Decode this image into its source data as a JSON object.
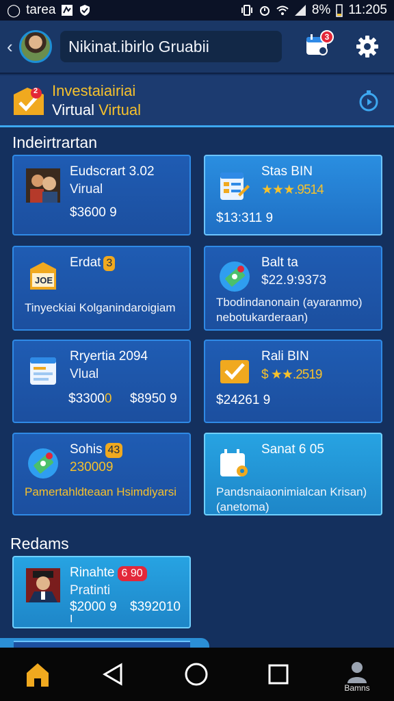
{
  "status_bar": {
    "carrier": "tarea",
    "battery": "8%",
    "time": "11:205"
  },
  "header": {
    "title": "Nikinat.ibirlo Gruabii",
    "calendar_badge": "3"
  },
  "banner": {
    "line1": "Investaiairiai",
    "line2_a": "Virtual",
    "line2_b": "Virtual",
    "badge": "2"
  },
  "section_investments": "Indeirtrartan",
  "cards": [
    {
      "title": "Eudscrart 3.02",
      "sub": "Virual",
      "price": "$3600 9"
    },
    {
      "title": "Stas BIN",
      "rating": "★★★.9514",
      "price": "$13:311 9"
    },
    {
      "title": "Erdat",
      "pill": "3",
      "desc1": "Tinyeckiai Kolganindaroigiam",
      "icon_text": "JOE"
    },
    {
      "title": "Balt ta",
      "sub": "$22.9:9373",
      "desc1": "Tbodindanonain (ayaranmo)",
      "desc2": "nebotukarderaan)"
    },
    {
      "title": "Rryertia 2094",
      "sub": "Vlual",
      "price": "$3300",
      "price_b": "0",
      "price2": "$8950 9"
    },
    {
      "title": "Rali BIN",
      "rating": "$ ★★.2519",
      "price": "$24261 9"
    },
    {
      "title": "Sohis",
      "pill": "43",
      "sub": "230009",
      "desc1": "Pamertahldteaan Hsimdiyarsi"
    },
    {
      "title": "Sanat 6 05",
      "desc1": "Pandsnaiaonimialcan Krisan)",
      "desc2": "(anetoma)"
    }
  ],
  "section_redeems": "Redams",
  "redeem_card": {
    "title": "Rinahte",
    "pill": "6 90",
    "sub": "Pratinti",
    "price": "$2000 9",
    "price2": "$392010",
    "mark": "I"
  },
  "navbar": {
    "profile_label": "Bamns"
  },
  "colors": {
    "background": "#14305e",
    "accent_gold": "#f6c12c",
    "accent_blue": "#2f8ae6",
    "badge_red": "#e32738"
  }
}
